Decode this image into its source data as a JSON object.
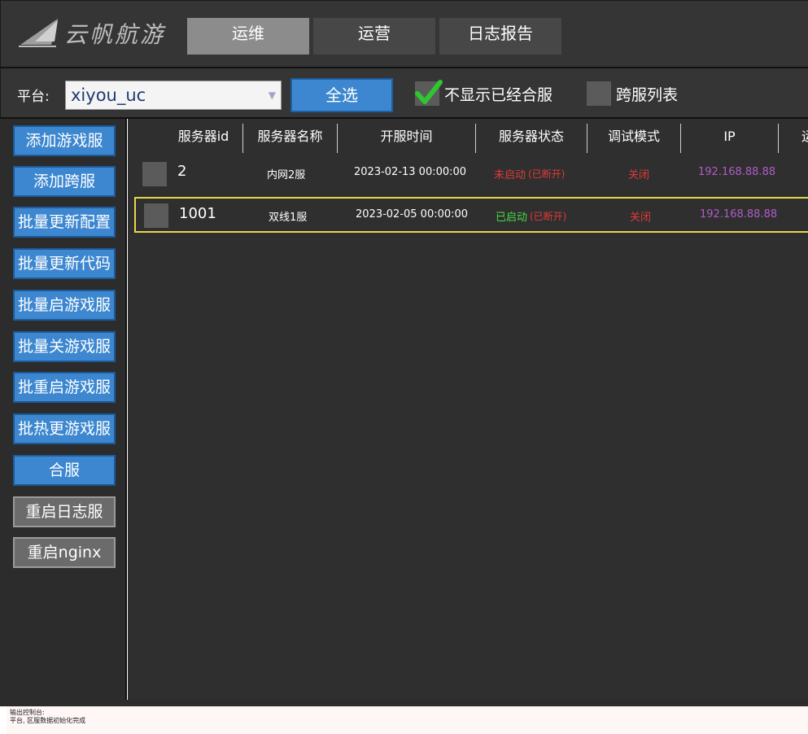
{
  "logo": {
    "text": "云帆航游"
  },
  "nav": {
    "tabs": [
      {
        "label": "运维",
        "active": true
      },
      {
        "label": "运营",
        "active": false
      },
      {
        "label": "日志报告",
        "active": false
      }
    ]
  },
  "filter": {
    "platform_label": "平台:",
    "platform_value": "xiyou_uc",
    "select_all": "全选",
    "hide_merged_label": "不显示已经合服",
    "hide_merged_checked": true,
    "cross_list_label": "跨服列表",
    "cross_list_checked": false
  },
  "sidebar": {
    "buttons": [
      {
        "label": "添加游戏服",
        "style": "blue"
      },
      {
        "label": "添加跨服",
        "style": "blue"
      },
      {
        "label": "批量更新配置",
        "style": "blue"
      },
      {
        "label": "批量更新代码",
        "style": "blue"
      },
      {
        "label": "批量启游戏服",
        "style": "blue"
      },
      {
        "label": "批量关游戏服",
        "style": "blue"
      },
      {
        "label": "批重启游戏服",
        "style": "blue"
      },
      {
        "label": "批热更游戏服",
        "style": "blue"
      },
      {
        "label": "合服",
        "style": "blue"
      },
      {
        "label": "重启日志服",
        "style": "gray"
      },
      {
        "label": "重启nginx",
        "style": "gray"
      }
    ]
  },
  "table": {
    "headers": [
      "服务器id",
      "服务器名称",
      "开服时间",
      "服务器状态",
      "调试模式",
      "IP",
      "运"
    ],
    "rows": [
      {
        "id": "2",
        "name": "内网2服",
        "open_time": "2023-02-13 00:00:00",
        "status": "未启动",
        "status_color": "#e03a3a",
        "conn": "(已断开)",
        "debug": "关闭",
        "ip": "192.168.88.88",
        "selected": false
      },
      {
        "id": "1001",
        "name": "双线1服",
        "open_time": "2023-02-05 00:00:00",
        "status": "已启动",
        "status_color": "#44dd44",
        "conn": "(已断开)",
        "debug": "关闭",
        "ip": "192.168.88.88",
        "selected": true
      }
    ]
  },
  "console": {
    "title": "输出控制台:",
    "line": "平台, 区服数据初始化完成"
  },
  "colors": {
    "accent_blue": "#3c87d0",
    "danger_red": "#e03a3a",
    "ip_purple": "#b05cc8",
    "select_yellow": "#e6d84a"
  }
}
